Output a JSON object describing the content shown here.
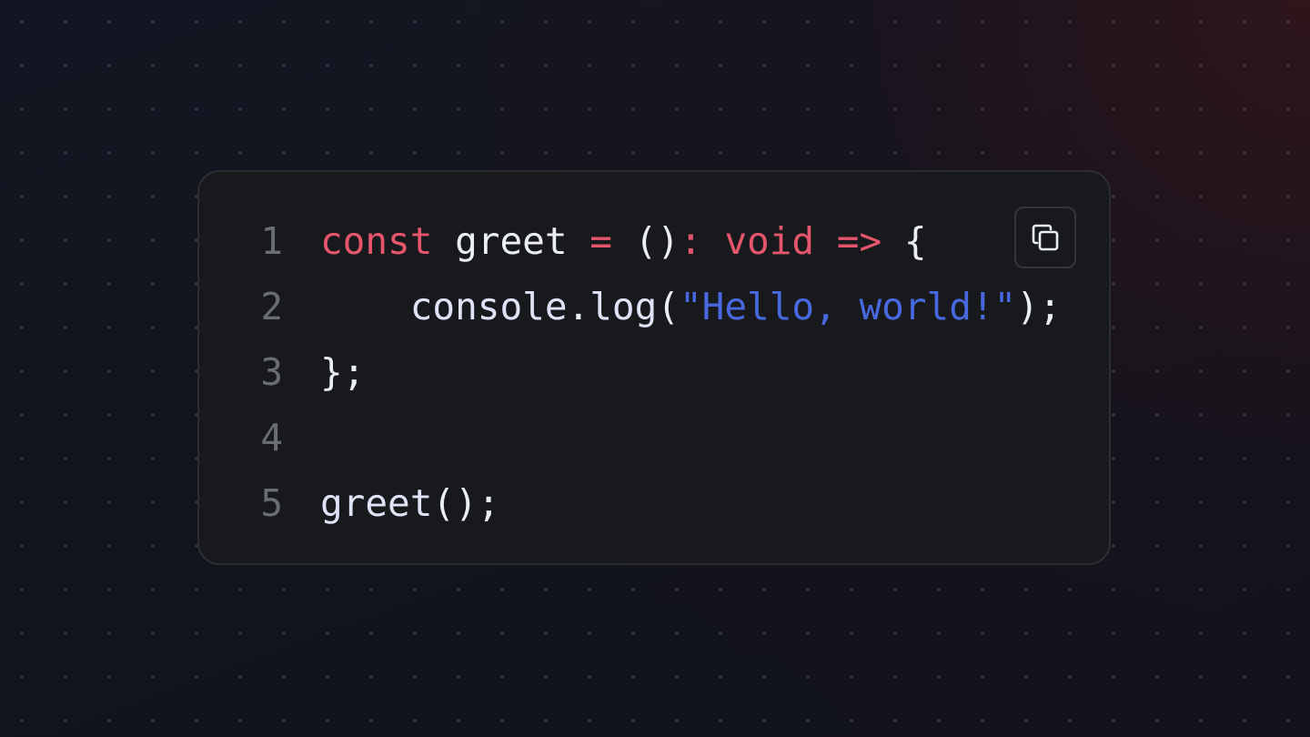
{
  "copy_button": {
    "icon": "copy-icon"
  },
  "code": {
    "lines": [
      {
        "number": "1",
        "tokens": [
          {
            "text": "const",
            "kind": "keyword"
          },
          {
            "text": " ",
            "kind": "space"
          },
          {
            "text": "greet",
            "kind": "identifier"
          },
          {
            "text": " ",
            "kind": "space"
          },
          {
            "text": "=",
            "kind": "operator"
          },
          {
            "text": " ",
            "kind": "space"
          },
          {
            "text": "()",
            "kind": "punctuation"
          },
          {
            "text": ":",
            "kind": "operator"
          },
          {
            "text": " ",
            "kind": "space"
          },
          {
            "text": "void",
            "kind": "keyword"
          },
          {
            "text": " ",
            "kind": "space"
          },
          {
            "text": "=>",
            "kind": "operator"
          },
          {
            "text": " ",
            "kind": "space"
          },
          {
            "text": "{",
            "kind": "punctuation"
          }
        ]
      },
      {
        "number": "2",
        "tokens": [
          {
            "text": "    ",
            "kind": "space"
          },
          {
            "text": "console",
            "kind": "function"
          },
          {
            "text": ".",
            "kind": "punctuation"
          },
          {
            "text": "log",
            "kind": "function"
          },
          {
            "text": "(",
            "kind": "punctuation"
          },
          {
            "text": "\"Hello, world!\"",
            "kind": "string"
          },
          {
            "text": ");",
            "kind": "punctuation"
          }
        ]
      },
      {
        "number": "3",
        "tokens": [
          {
            "text": "};",
            "kind": "punctuation"
          }
        ]
      },
      {
        "number": "4",
        "tokens": []
      },
      {
        "number": "5",
        "tokens": [
          {
            "text": "greet",
            "kind": "function"
          },
          {
            "text": "();",
            "kind": "punctuation"
          }
        ]
      }
    ]
  },
  "colors": {
    "keyword": "#e5566d",
    "string": "#4868e0",
    "identifier": "#eceef5",
    "line_number": "#6b6d74",
    "card_background": "#18191c",
    "page_background": "#11131c"
  }
}
